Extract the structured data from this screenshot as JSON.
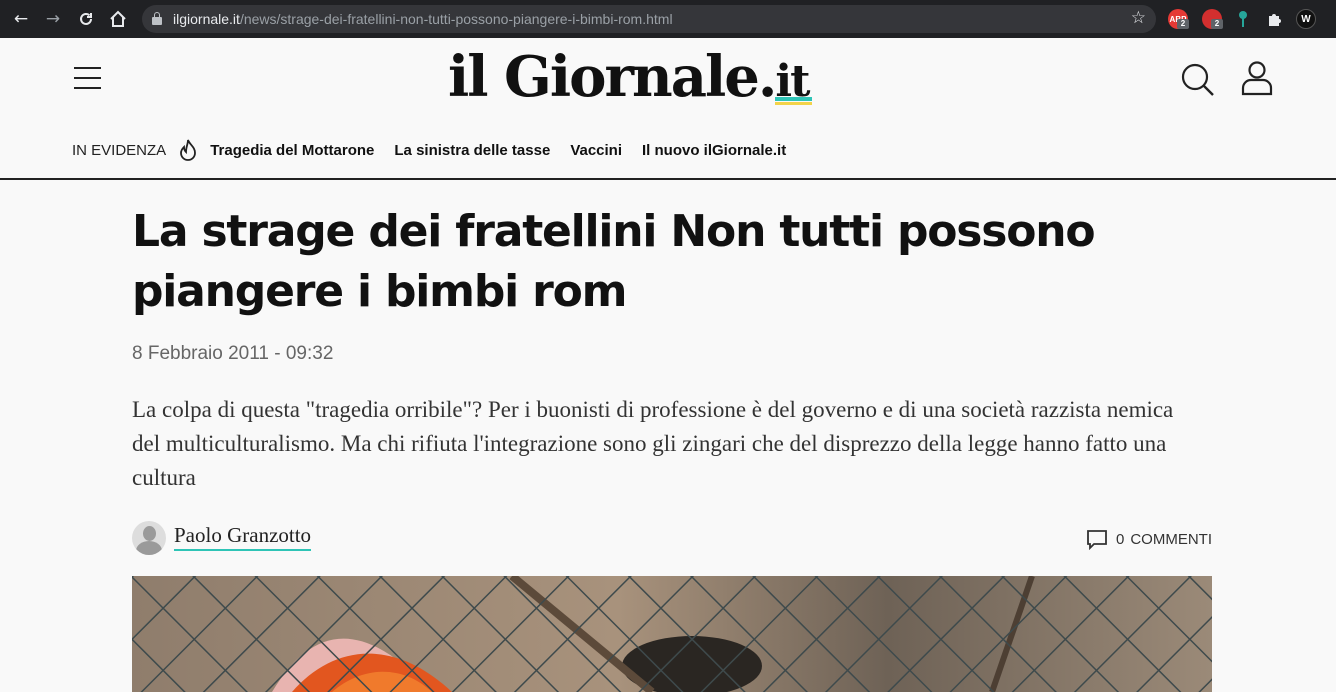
{
  "browser": {
    "url_host": "ilgiornale.it",
    "url_path": "/news/strage-dei-fratellini-non-tutti-possono-piangere-i-bimbi-rom.html",
    "extensions": [
      {
        "name": "abp-extension",
        "label": "ABP",
        "badge": "2",
        "color": "#e53935"
      },
      {
        "name": "privacy-extension",
        "label": "",
        "badge": "2",
        "color": "#d32f2f"
      },
      {
        "name": "key-extension",
        "label": "",
        "badge": "",
        "color": "#26a69a"
      },
      {
        "name": "wp-extension",
        "label": "W",
        "badge": "",
        "color": "#111111"
      }
    ]
  },
  "site": {
    "logo_main": "il Giornale",
    "logo_dot": ".",
    "logo_tld": "it",
    "accent_color": "#2ec4b6"
  },
  "evidenza": {
    "label": "IN EVIDENZA",
    "links": [
      "Tragedia del Mottarone",
      "La sinistra delle tasse",
      "Vaccini",
      "Il nuovo ilGiornale.it"
    ]
  },
  "article": {
    "title": "La strage dei fratellini Non tutti possono piangere i bimbi rom",
    "date": "8 Febbraio 2011 - 09:32",
    "summary": "La colpa di questa \"tragedia orribile\"? Per i buonisti di professione è del governo e di una società razzista nemica del multiculturalismo. Ma chi rifiuta l'integrazione sono gli zingari che del disprezzo della legge hanno fatto una cultura",
    "author": "Paolo Granzotto",
    "comments_count": "0",
    "comments_label": "COMMENTI"
  }
}
